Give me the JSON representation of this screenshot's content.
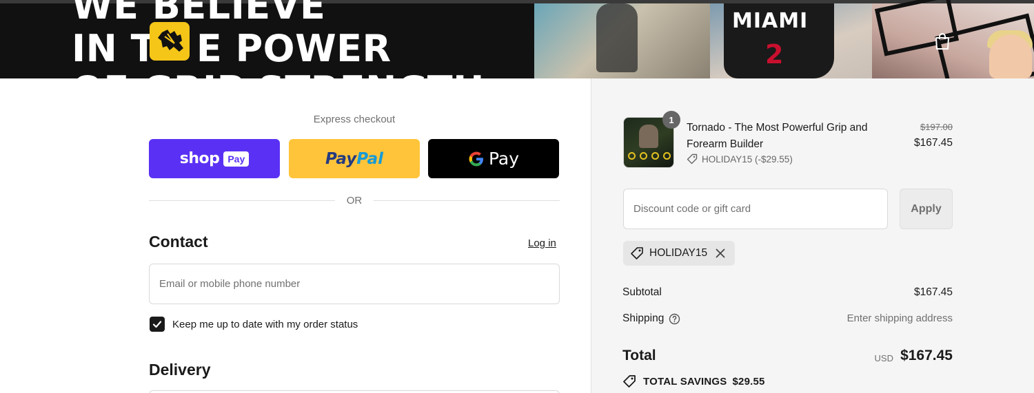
{
  "banner": {
    "slogan_line_1": "WE BELIEVE",
    "slogan_line_2_a": "IN T",
    "slogan_line_2_b": "E POWER",
    "slogan_line_3": "OF GRIP STRENGTH",
    "jersey_text": "MIAMI",
    "jersey_number": "2",
    "fist_icon": "fist-icon",
    "cart_icon": "shopping-bag-icon"
  },
  "express_checkout": {
    "label": "Express checkout",
    "shop_pay": {
      "word": "shop",
      "pill": "Pay",
      "color": "#5a31f4"
    },
    "paypal": {
      "part_a": "Pay",
      "part_b": "Pal",
      "color": "#ffc439"
    },
    "gpay": {
      "word": "Pay",
      "color": "#000000"
    },
    "separator": "OR"
  },
  "contact": {
    "heading": "Contact",
    "login_link": "Log in",
    "email_placeholder": "Email or mobile phone number",
    "email_value": "",
    "keep_updated_label": "Keep me up to date with my order status",
    "keep_updated_checked": true
  },
  "delivery": {
    "heading": "Delivery"
  },
  "order_summary": {
    "item": {
      "quantity": "1",
      "name": "Tornado - The Most Powerful Grip and Forearm Builder",
      "discount_line": "HOLIDAY15 (-$29.55)",
      "price_original": "$197.00",
      "price_current": "$167.45"
    },
    "discount_input_placeholder": "Discount code or gift card",
    "apply_label": "Apply",
    "applied_code": "HOLIDAY15",
    "subtotal_label": "Subtotal",
    "subtotal_value": "$167.45",
    "shipping_label": "Shipping",
    "shipping_value": "Enter shipping address",
    "total_label": "Total",
    "total_currency": "USD",
    "total_value": "$167.45",
    "savings_label": "TOTAL SAVINGS",
    "savings_value": "$29.55"
  },
  "colors": {
    "summary_bg": "#f5f5f5",
    "badge_yellow": "#f5c518",
    "text_primary": "#1a1a1a",
    "text_muted": "#707070"
  }
}
